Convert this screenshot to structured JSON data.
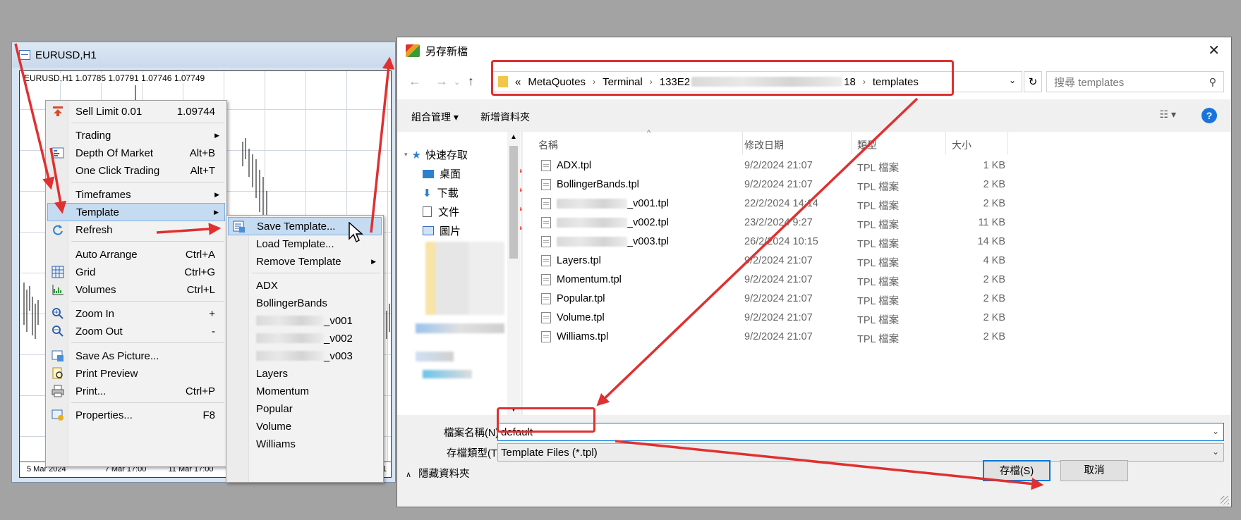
{
  "chart_window": {
    "title": "EURUSD,H1",
    "info": "EURUSD,H1  1.07785 1.07791 1.07746 1.07749",
    "axis_labels": [
      "5 Mar 2024",
      "7 Mar 17:00",
      "11 Mar 17:00",
      "1"
    ]
  },
  "context_menu": {
    "items": [
      {
        "label": "Sell Limit 0.01",
        "shortcut": "1.09744",
        "icon": "sell-arrow-icon"
      },
      {
        "label": "Trading",
        "shortcut": "",
        "arrow": "▶"
      },
      {
        "label": "Depth Of Market",
        "shortcut": "Alt+B",
        "icon": "depth-icon"
      },
      {
        "label": "One Click Trading",
        "shortcut": "Alt+T"
      },
      {
        "label": "Timeframes",
        "shortcut": "",
        "arrow": "▶"
      },
      {
        "label": "Template",
        "shortcut": "",
        "arrow": "▶"
      },
      {
        "label": "Refresh",
        "shortcut": "",
        "icon": "refresh-icon"
      },
      {
        "label": "Auto Arrange",
        "shortcut": "Ctrl+A"
      },
      {
        "label": "Grid",
        "shortcut": "Ctrl+G",
        "icon": "grid-icon"
      },
      {
        "label": "Volumes",
        "shortcut": "Ctrl+L",
        "icon": "volumes-icon"
      },
      {
        "label": "Zoom In",
        "shortcut": "+",
        "icon": "zoom-in-icon"
      },
      {
        "label": "Zoom Out",
        "shortcut": "-",
        "icon": "zoom-out-icon"
      },
      {
        "label": "Save As Picture...",
        "shortcut": "",
        "icon": "save-picture-icon"
      },
      {
        "label": "Print Preview",
        "shortcut": "",
        "icon": "print-preview-icon"
      },
      {
        "label": "Print...",
        "shortcut": "Ctrl+P",
        "icon": "printer-icon"
      },
      {
        "label": "Properties...",
        "shortcut": "F8",
        "icon": "properties-icon"
      }
    ]
  },
  "template_submenu": {
    "items": [
      {
        "label": "Save Template...",
        "icon": "save-template-icon"
      },
      {
        "label": "Load Template..."
      },
      {
        "label": "Remove Template",
        "arrow": "▶"
      },
      {
        "label": "ADX"
      },
      {
        "label": "BollingerBands"
      },
      {
        "label": "_v001",
        "blurred": true
      },
      {
        "label": "_v002",
        "blurred": true
      },
      {
        "label": "_v003",
        "blurred": true
      },
      {
        "label": "Layers"
      },
      {
        "label": "Momentum"
      },
      {
        "label": "Popular"
      },
      {
        "label": "Volume"
      },
      {
        "label": "Williams"
      }
    ]
  },
  "dialog": {
    "title": "另存新檔",
    "breadcrumb": {
      "prefix": "«",
      "parts": [
        "MetaQuotes",
        "Terminal",
        "133E2",
        "18",
        "templates"
      ]
    },
    "search_placeholder": "搜尋 templates",
    "toolbar": {
      "organize": "組合管理 ▾",
      "new_folder": "新增資料夾"
    },
    "nav": {
      "quick_access": "快速存取",
      "items": [
        "桌面",
        "下載",
        "文件",
        "圖片"
      ]
    },
    "columns": {
      "name": "名稱",
      "date": "修改日期",
      "type": "類型",
      "size": "大小"
    },
    "files": [
      {
        "name": "ADX.tpl",
        "date": "9/2/2024 21:07",
        "type": "TPL 檔案",
        "size": "1 KB"
      },
      {
        "name": "BollingerBands.tpl",
        "date": "9/2/2024 21:07",
        "type": "TPL 檔案",
        "size": "2 KB"
      },
      {
        "name": "_v001.tpl",
        "date": "22/2/2024 14:14",
        "type": "TPL 檔案",
        "size": "2 KB",
        "blurred": true
      },
      {
        "name": "_v002.tpl",
        "date": "23/2/2024 9:27",
        "type": "TPL 檔案",
        "size": "11 KB",
        "blurred": true
      },
      {
        "name": "_v003.tpl",
        "date": "26/2/2024 10:15",
        "type": "TPL 檔案",
        "size": "14 KB",
        "blurred": true
      },
      {
        "name": "Layers.tpl",
        "date": "9/2/2024 21:07",
        "type": "TPL 檔案",
        "size": "4 KB"
      },
      {
        "name": "Momentum.tpl",
        "date": "9/2/2024 21:07",
        "type": "TPL 檔案",
        "size": "2 KB"
      },
      {
        "name": "Popular.tpl",
        "date": "9/2/2024 21:07",
        "type": "TPL 檔案",
        "size": "2 KB"
      },
      {
        "name": "Volume.tpl",
        "date": "9/2/2024 21:07",
        "type": "TPL 檔案",
        "size": "2 KB"
      },
      {
        "name": "Williams.tpl",
        "date": "9/2/2024 21:07",
        "type": "TPL 檔案",
        "size": "2 KB"
      }
    ],
    "filename_label": "檔案名稱(N):",
    "filename_value": "default",
    "filetype_label": "存檔類型(T):",
    "filetype_value": "Template Files (*.tpl)",
    "hide_folders": "隱藏資料夾",
    "save_label": "存檔(S)",
    "cancel_label": "取消"
  },
  "colors": {
    "annotation": "#e03030",
    "menu_highlight": "#c5dbf1",
    "accent": "#0078d7"
  }
}
